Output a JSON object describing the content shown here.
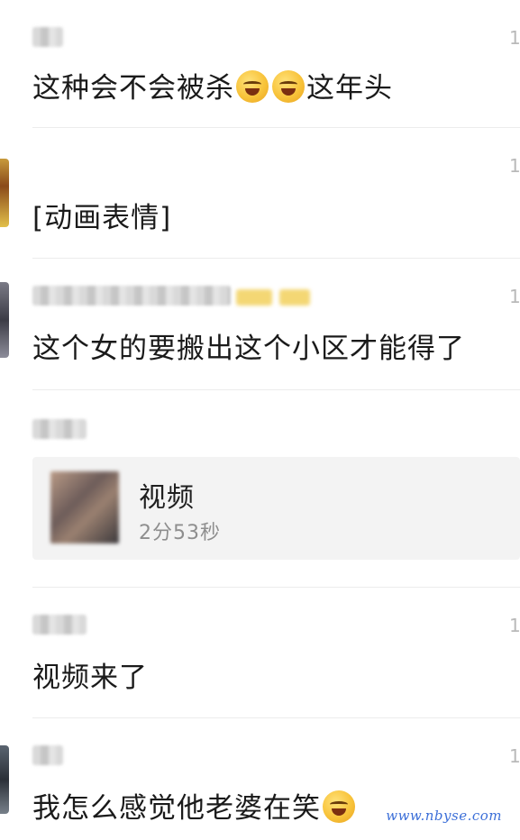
{
  "comments": [
    {
      "time": "1",
      "text": "这种会不会被杀",
      "emoji_count_mid": 2,
      "text_after": "这年头"
    },
    {
      "time": "1",
      "text": "[动画表情]"
    },
    {
      "time": "1",
      "text": "这个女的要搬出这个小区才能得了"
    },
    {
      "time": "",
      "card": {
        "title": "视频",
        "duration": "2分53秒"
      }
    },
    {
      "time": "1",
      "text": "视频来了"
    },
    {
      "time": "1",
      "text": "我怎么感觉他老婆在笑"
    }
  ],
  "colors": {
    "accent_watermark": "#3c6fd8",
    "text": "#1a1a1a",
    "muted": "#8e8e8e"
  },
  "icons": {
    "emoji": "laughing-crying-emoji-icon",
    "video_thumb": "video-thumbnail"
  },
  "watermark": "www.nbyse.com"
}
